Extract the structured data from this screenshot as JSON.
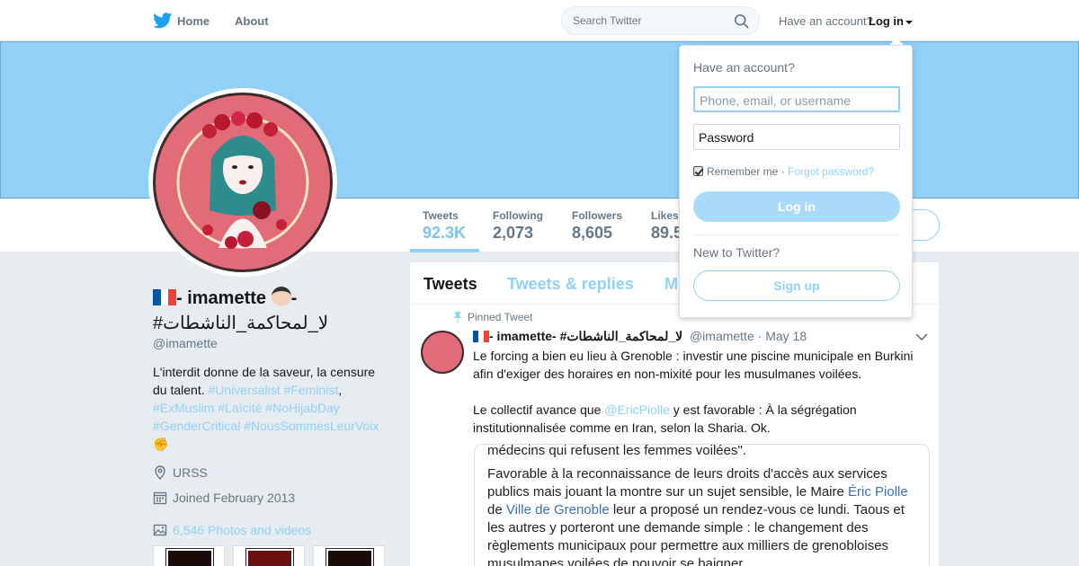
{
  "nav": {
    "home": "Home",
    "about": "About",
    "search_placeholder": "Search Twitter",
    "have_account": "Have an account?",
    "login": "Log in"
  },
  "stats": [
    {
      "label": "Tweets",
      "value": "92.3K"
    },
    {
      "label": "Following",
      "value": "2,073"
    },
    {
      "label": "Followers",
      "value": "8,605"
    },
    {
      "label": "Likes",
      "value": "89.5"
    }
  ],
  "profile": {
    "name_part1": "- imamette",
    "name_part2": "- ",
    "name_arabic": "#لا_لمحاكمة_الناشطات",
    "handle": "@imamette",
    "bio_text": "L'interdit donne de la saveur, la censure du talent. ",
    "bio_links": [
      "#Universalist",
      "#Feminist",
      "#ExMuslim",
      "#Laïcité",
      "#NoHijabDay",
      "#GenderCritical",
      "#NousSommesLeurVoix"
    ],
    "bio_emoji": "✊",
    "location": "URSS",
    "joined": "Joined February 2013",
    "photos": "6,546 Photos and videos"
  },
  "tabs": [
    "Tweets",
    "Tweets & replies",
    "M"
  ],
  "tweet": {
    "pinned_label": "Pinned Tweet",
    "author_name": "- imamette",
    "author_suffix": "- #لا_لمحاكمة_الناشطات",
    "handle": "@imamette",
    "date": "May 18",
    "text_line1": "Le forcing a bien eu lieu à Grenoble : investir une piscine municipale en Burkini afin d'exiger des horaires en non-mixité pour les musulmanes voilées.",
    "text_line2_pre": "Le collectif avance que ",
    "text_mention": "@EricPiolle",
    "text_line2_post": " y est favorable : À la ségrégation institutionnalisée comme en Iran, selon la Sharia. Ok.",
    "card_line1": "médecins qui refusent les femmes voilées\".",
    "card_p2_a": "Favorable à la reconnaissance de leurs droits d'accès aux services publics mais jouant la montre sur un sujet sensible, le Maire ",
    "card_p2_link1": "Éric Piolle",
    "card_p2_b": " de ",
    "card_p2_link2": "Ville de Grenoble",
    "card_p2_c": " leur a proposé un rendez-vous ce lundi. Taous et les autres y porteront une demande simple : le changement des règlements municipaux pour permettre aux milliers de grenobloises musulmanes voilées de pouvoir se baigner"
  },
  "login_dropdown": {
    "title": "Have an account?",
    "username_placeholder": "Phone, email, or username",
    "password_placeholder": "Password",
    "remember": "Remember me",
    "separator": " · ",
    "forgot": "Forgot password?",
    "login_button": "Log in",
    "new_to_twitter": "New to Twitter?",
    "signup_button": "Sign up"
  },
  "colors": {
    "accent": "#91d1f7",
    "banner": "#91d1f7",
    "avatar_bg": "#e16b76"
  }
}
